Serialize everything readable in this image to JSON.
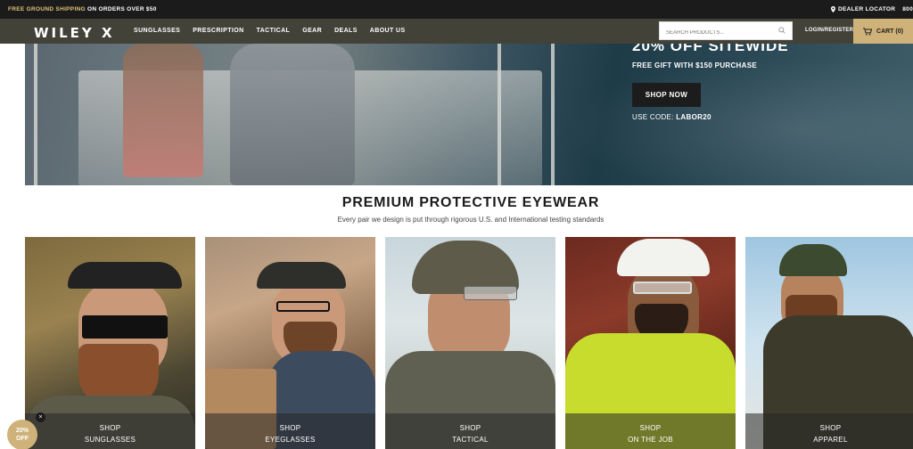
{
  "topbar": {
    "promo_highlight": "FREE GROUND SHIPPING",
    "promo_rest": "ON ORDERS OVER $50",
    "dealer_locator": "DEALER LOCATOR",
    "phone_partial": "800"
  },
  "nav": {
    "logo": "WILEY X",
    "menu": [
      "SUNGLASSES",
      "PRESCRIPTION",
      "TACTICAL",
      "GEAR",
      "DEALS",
      "ABOUT US"
    ],
    "search_placeholder": "SEARCH PRODUCTS...",
    "login": "LOGIN/REGISTER",
    "cart": "CART (0)"
  },
  "hero": {
    "headline": "20% OFF SITEWIDE",
    "subline": "FREE GIFT WITH $150 PURCHASE",
    "button": "SHOP NOW",
    "code_prefix": "USE CODE:",
    "code": "LABOR20"
  },
  "section": {
    "title": "PREMIUM PROTECTIVE EYEWEAR",
    "subtitle": "Every pair we design is put through rigorous U.S. and International testing standards"
  },
  "categories": [
    {
      "line1": "SHOP",
      "line2": "SUNGLASSES"
    },
    {
      "line1": "SHOP",
      "line2": "EYEGLASSES"
    },
    {
      "line1": "SHOP",
      "line2": "TACTICAL"
    },
    {
      "line1": "SHOP",
      "line2": "ON THE JOB"
    },
    {
      "line1": "SHOP",
      "line2": "APPAREL"
    }
  ],
  "promo_badge": {
    "line1": "20%",
    "line2": "OFF",
    "close": "×"
  },
  "colors": {
    "topbar_bg": "#1b1b1b",
    "nav_bg": "#434239",
    "accent_gold": "#cfb27a"
  },
  "icons": [
    "location-pin-icon",
    "search-icon",
    "cart-icon",
    "close-icon"
  ]
}
